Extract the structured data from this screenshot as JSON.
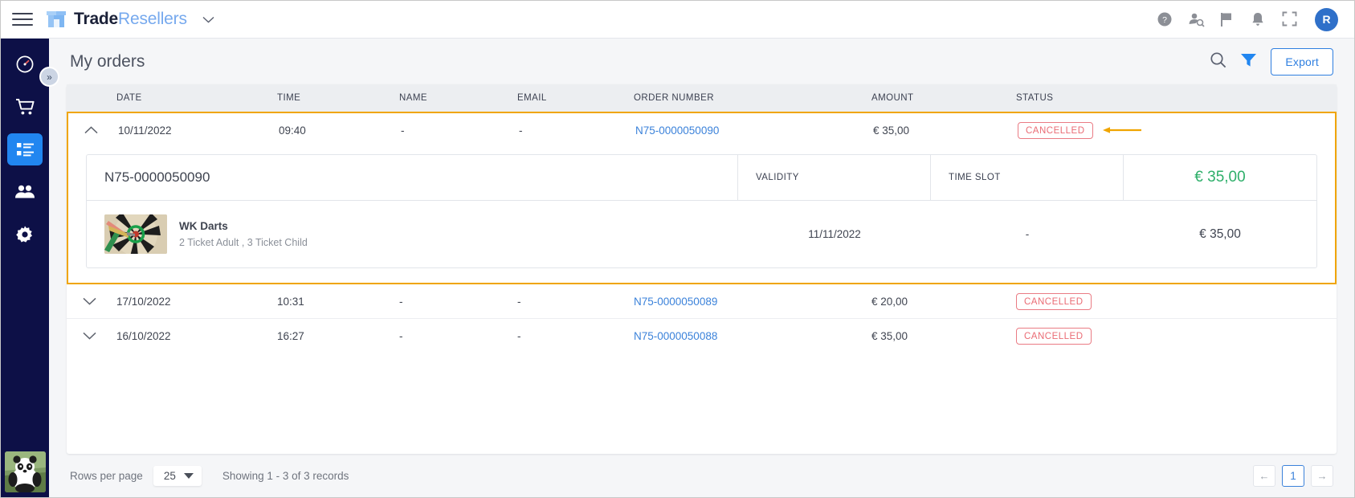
{
  "topbar": {
    "brand_first": "Trade",
    "brand_second": "Resellers",
    "icons": [
      "help-icon",
      "user-search-icon",
      "flag-icon",
      "bell-icon",
      "fullscreen-icon"
    ],
    "avatar_initial": "R"
  },
  "sidebar": {
    "items": [
      {
        "name": "dashboard",
        "icon": "speedometer-icon",
        "active": false
      },
      {
        "name": "shop",
        "icon": "shopping-cart-icon",
        "active": false
      },
      {
        "name": "orders",
        "icon": "list-icon",
        "active": true
      },
      {
        "name": "customers",
        "icon": "users-icon",
        "active": false
      },
      {
        "name": "settings",
        "icon": "gear-icon",
        "active": false
      }
    ],
    "collapse_label": "»",
    "footer_logo": "panda-logo"
  },
  "page": {
    "title": "My orders",
    "search_icon": "search-icon",
    "filter_icon": "filter-icon",
    "export_label": "Export"
  },
  "table": {
    "columns": [
      "DATE",
      "TIME",
      "NAME",
      "EMAIL",
      "ORDER NUMBER",
      "AMOUNT",
      "STATUS"
    ],
    "rows": [
      {
        "date": "10/11/2022",
        "time": "09:40",
        "name": "-",
        "email": "-",
        "order_number": "N75-0000050090",
        "amount": "€ 35,00",
        "status": "CANCELLED",
        "expanded": true,
        "highlighted": true,
        "annotated": true
      },
      {
        "date": "17/10/2022",
        "time": "10:31",
        "name": "-",
        "email": "-",
        "order_number": "N75-0000050089",
        "amount": "€ 20,00",
        "status": "CANCELLED",
        "expanded": false,
        "highlighted": false,
        "annotated": false
      },
      {
        "date": "16/10/2022",
        "time": "16:27",
        "name": "-",
        "email": "-",
        "order_number": "N75-0000050088",
        "amount": "€ 35,00",
        "status": "CANCELLED",
        "expanded": false,
        "highlighted": false,
        "annotated": false
      }
    ]
  },
  "detail": {
    "order_number": "N75-0000050090",
    "validity_label": "VALIDITY",
    "timeslot_label": "TIME SLOT",
    "total": "€ 35,00",
    "product_name": "WK Darts",
    "product_sub": "2 Ticket Adult , 3 Ticket Child",
    "product_thumb": "dartboard-thumbnail",
    "validity_value": "11/11/2022",
    "timeslot_value": "-",
    "line_total": "€ 35,00"
  },
  "footer": {
    "rows_per_page_label": "Rows per page",
    "rows_per_page_value": "25",
    "showing": "Showing 1 - 3 of 3 records",
    "prev_label": "←",
    "next_label": "→",
    "current_page": "1"
  },
  "colors": {
    "accent_blue": "#2186f0",
    "link_blue": "#3b82da",
    "sidebar_navy": "#0d1047",
    "status_red": "#ea6b74",
    "highlight_orange": "#f0a500",
    "total_green": "#2eaf6a"
  }
}
